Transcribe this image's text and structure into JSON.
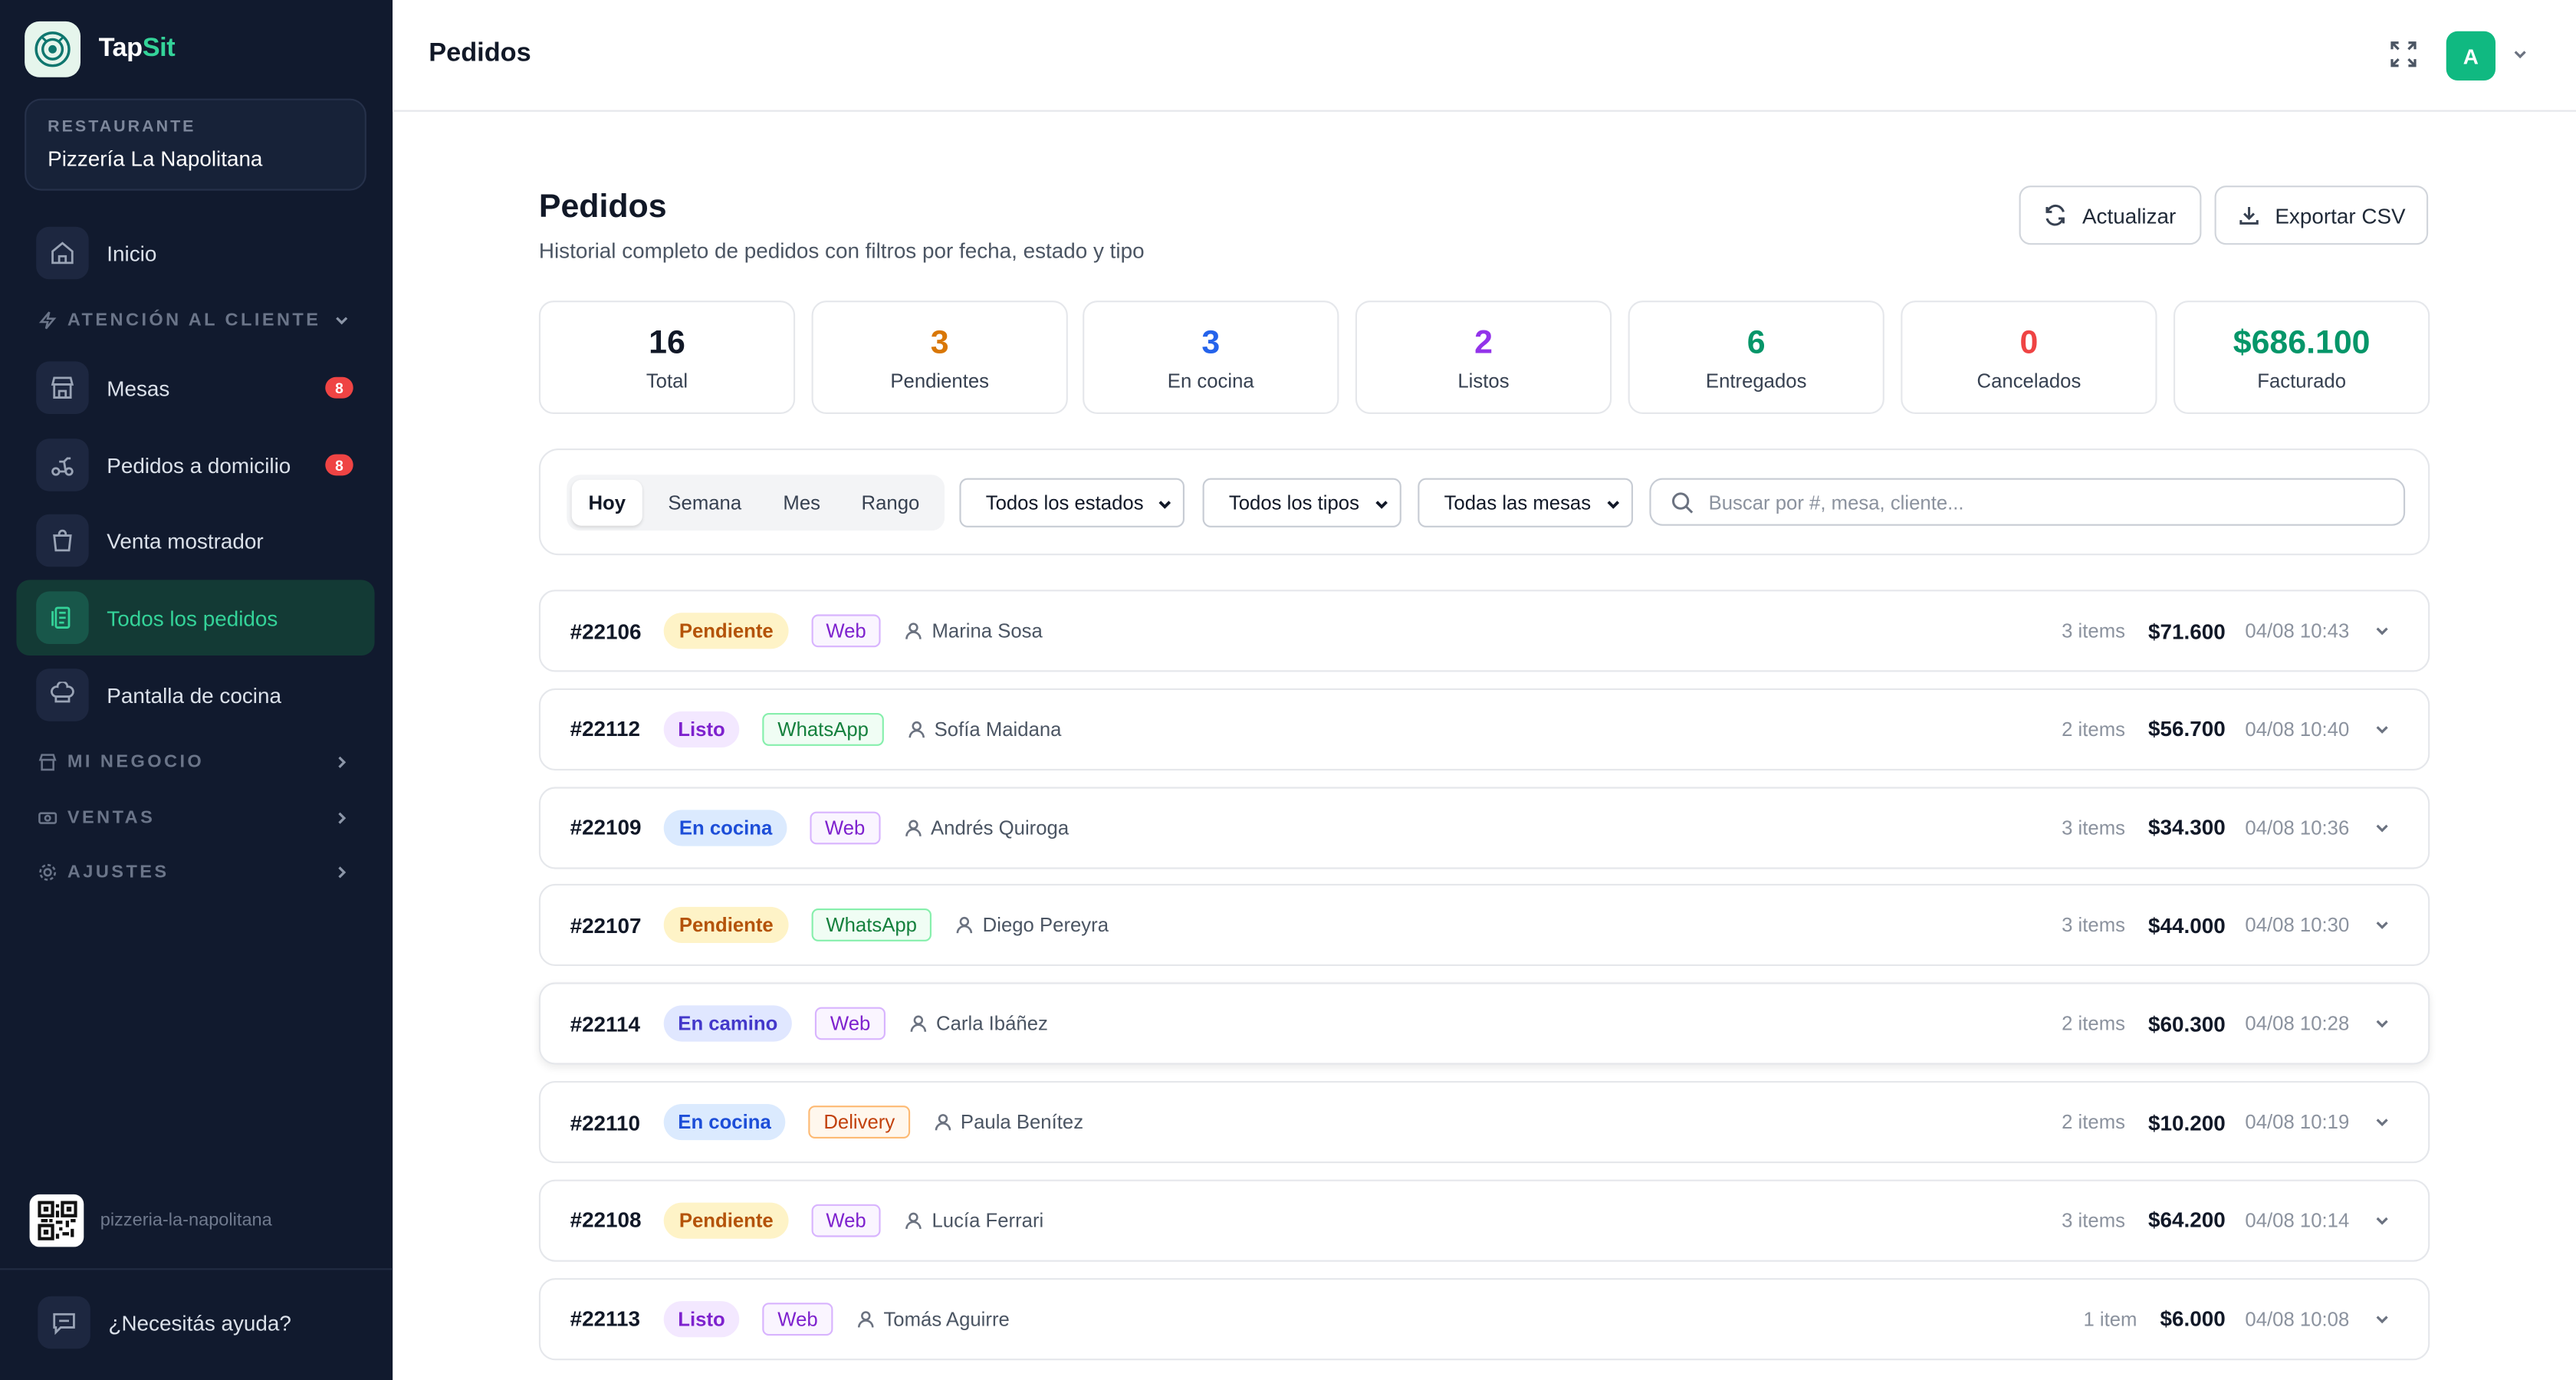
{
  "app": {
    "brand_part1": "Tap",
    "brand_part2": "Sit",
    "restaurant_label": "RESTAURANTE",
    "restaurant_name": "Pizzería La Napolitana"
  },
  "sidebar": {
    "items": [
      {
        "label": "Inicio",
        "icon": "home-icon"
      },
      {
        "label": "Mesas",
        "icon": "store-icon",
        "badge": "8"
      },
      {
        "label": "Pedidos a domicilio",
        "icon": "scooter-icon",
        "badge": "8"
      },
      {
        "label": "Venta mostrador",
        "icon": "bag-icon"
      },
      {
        "label": "Todos los pedidos",
        "icon": "receipt-icon",
        "active": true
      },
      {
        "label": "Pantalla de cocina",
        "icon": "chef-hat-icon"
      }
    ],
    "sections": {
      "atencion": "ATENCIÓN AL CLIENTE",
      "negocio": "MI NEGOCIO",
      "ventas": "VENTAS",
      "ajustes": "AJUSTES"
    },
    "slug": "pizzeria-la-napolitana",
    "help": "¿Necesitás ayuda?"
  },
  "topbar": {
    "title": "Pedidos",
    "avatar_initial": "A"
  },
  "main": {
    "title": "Pedidos",
    "subtitle": "Historial completo de pedidos con filtros por fecha, estado y tipo",
    "refresh_label": "Actualizar",
    "export_label": "Exportar CSV"
  },
  "stats": [
    {
      "value": "16",
      "label": "Total",
      "color": "#111827"
    },
    {
      "value": "3",
      "label": "Pendientes",
      "color": "#d97706"
    },
    {
      "value": "3",
      "label": "En cocina",
      "color": "#2563eb"
    },
    {
      "value": "2",
      "label": "Listos",
      "color": "#9333ea"
    },
    {
      "value": "6",
      "label": "Entregados",
      "color": "#059669"
    },
    {
      "value": "0",
      "label": "Cancelados",
      "color": "#ef4444"
    },
    {
      "value": "$686.100",
      "label": "Facturado",
      "color": "#059669"
    }
  ],
  "filters": {
    "periods": [
      "Hoy",
      "Semana",
      "Mes",
      "Rango"
    ],
    "active_period": "Hoy",
    "status_select": "Todos los estados",
    "type_select": "Todos los tipos",
    "table_select": "Todas las mesas",
    "search_placeholder": "Buscar por #, mesa, cliente..."
  },
  "orders": [
    {
      "id": "#22106",
      "status": "Pendiente",
      "channel": "Web",
      "customer": "Marina Sosa",
      "items": "3 items",
      "amount": "$71.600",
      "date": "04/08 10:43"
    },
    {
      "id": "#22112",
      "status": "Listo",
      "channel": "WhatsApp",
      "customer": "Sofía Maidana",
      "items": "2 items",
      "amount": "$56.700",
      "date": "04/08 10:40"
    },
    {
      "id": "#22109",
      "status": "En cocina",
      "channel": "Web",
      "customer": "Andrés Quiroga",
      "items": "3 items",
      "amount": "$34.300",
      "date": "04/08 10:36"
    },
    {
      "id": "#22107",
      "status": "Pendiente",
      "channel": "WhatsApp",
      "customer": "Diego Pereyra",
      "items": "3 items",
      "amount": "$44.000",
      "date": "04/08 10:30"
    },
    {
      "id": "#22114",
      "status": "En camino",
      "channel": "Web",
      "customer": "Carla Ibáñez",
      "items": "2 items",
      "amount": "$60.300",
      "date": "04/08 10:28"
    },
    {
      "id": "#22110",
      "status": "En cocina",
      "channel": "Delivery",
      "customer": "Paula Benítez",
      "items": "2 items",
      "amount": "$10.200",
      "date": "04/08 10:19"
    },
    {
      "id": "#22108",
      "status": "Pendiente",
      "channel": "Web",
      "customer": "Lucía Ferrari",
      "items": "3 items",
      "amount": "$64.200",
      "date": "04/08 10:14"
    },
    {
      "id": "#22113",
      "status": "Listo",
      "channel": "Web",
      "customer": "Tomás Aguirre",
      "items": "1 item",
      "amount": "$6.000",
      "date": "04/08 10:08"
    }
  ],
  "colors": {
    "sidebar_bg": "#111a2e",
    "accent": "#34d399",
    "status_pendiente": "#fef3c7",
    "status_listo": "#f3e8ff",
    "status_en_cocina": "#dbeafe",
    "status_en_camino": "#e0e7ff",
    "badge": "#ef4444"
  }
}
